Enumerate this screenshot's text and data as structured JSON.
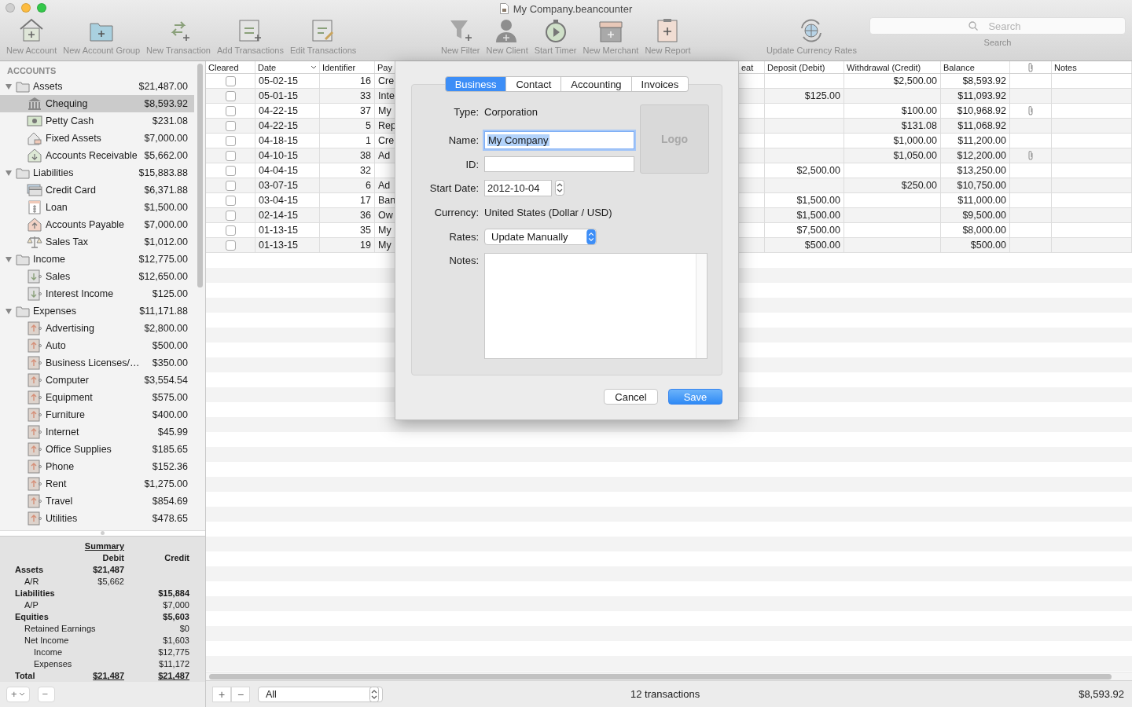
{
  "window": {
    "title": "My Company.beancounter"
  },
  "toolbar": {
    "groups": [
      {
        "items": [
          {
            "label": "New Account"
          },
          {
            "label": "New Account Group"
          },
          {
            "label": "New Transaction"
          },
          {
            "label": "Add Transactions"
          },
          {
            "label": "Edit Transactions"
          }
        ]
      },
      {
        "items": [
          {
            "label": "New Filter"
          },
          {
            "label": "New Client"
          },
          {
            "label": "Start Timer"
          },
          {
            "label": "New Merchant"
          },
          {
            "label": "New Report"
          }
        ]
      },
      {
        "items": [
          {
            "label": "Update Currency Rates"
          }
        ]
      }
    ],
    "search": {
      "placeholder": "Search",
      "label": "Search"
    }
  },
  "sidebar": {
    "heading": "ACCOUNTS",
    "groups": [
      {
        "name": "Assets",
        "amount": "$21,487.00",
        "expanded": true,
        "selected": false,
        "children": [
          {
            "name": "Chequing",
            "amount": "$8,593.92",
            "kind": "bank",
            "selected": true
          },
          {
            "name": "Petty Cash",
            "amount": "$231.08",
            "kind": "cash",
            "selected": false
          },
          {
            "name": "Fixed Assets",
            "amount": "$7,000.00",
            "kind": "asset",
            "selected": false
          },
          {
            "name": "Accounts Receivable",
            "amount": "$5,662.00",
            "kind": "receivable",
            "selected": false
          }
        ]
      },
      {
        "name": "Liabilities",
        "amount": "$15,883.88",
        "expanded": true,
        "selected": false,
        "children": [
          {
            "name": "Credit Card",
            "amount": "$6,371.88",
            "kind": "card",
            "selected": false
          },
          {
            "name": "Loan",
            "amount": "$1,500.00",
            "kind": "loan",
            "selected": false
          },
          {
            "name": "Accounts Payable",
            "amount": "$7,000.00",
            "kind": "payable",
            "selected": false
          },
          {
            "name": "Sales Tax",
            "amount": "$1,012.00",
            "kind": "tax",
            "selected": false
          }
        ]
      },
      {
        "name": "Income",
        "amount": "$12,775.00",
        "expanded": true,
        "selected": false,
        "children": [
          {
            "name": "Sales",
            "amount": "$12,650.00",
            "kind": "income",
            "selected": false
          },
          {
            "name": "Interest Income",
            "amount": "$125.00",
            "kind": "income",
            "selected": false
          }
        ]
      },
      {
        "name": "Expenses",
        "amount": "$11,171.88",
        "expanded": true,
        "selected": false,
        "children": [
          {
            "name": "Advertising",
            "amount": "$2,800.00",
            "kind": "expense",
            "selected": false
          },
          {
            "name": "Auto",
            "amount": "$500.00",
            "kind": "expense",
            "selected": false
          },
          {
            "name": "Business Licenses/…",
            "amount": "$350.00",
            "kind": "expense",
            "selected": false
          },
          {
            "name": "Computer",
            "amount": "$3,554.54",
            "kind": "expense",
            "selected": false
          },
          {
            "name": "Equipment",
            "amount": "$575.00",
            "kind": "expense",
            "selected": false
          },
          {
            "name": "Furniture",
            "amount": "$400.00",
            "kind": "expense",
            "selected": false
          },
          {
            "name": "Internet",
            "amount": "$45.99",
            "kind": "expense",
            "selected": false
          },
          {
            "name": "Office Supplies",
            "amount": "$185.65",
            "kind": "expense",
            "selected": false
          },
          {
            "name": "Phone",
            "amount": "$152.36",
            "kind": "expense",
            "selected": false
          },
          {
            "name": "Rent",
            "amount": "$1,275.00",
            "kind": "expense",
            "selected": false
          },
          {
            "name": "Travel",
            "amount": "$854.69",
            "kind": "expense",
            "selected": false
          },
          {
            "name": "Utilities",
            "amount": "$478.65",
            "kind": "expense",
            "selected": false
          }
        ]
      }
    ],
    "buttons": [
      {
        "label": "+"
      },
      {
        "label": "−"
      }
    ]
  },
  "summary": {
    "title": "Summary",
    "columns": [
      "Debit",
      "Credit"
    ],
    "rows": [
      {
        "label": "Assets",
        "debit": "$21,487",
        "children": [
          {
            "label": "A/R",
            "debit": "$5,662"
          }
        ]
      },
      {
        "label": "Liabilities",
        "credit": "$15,884",
        "children": [
          {
            "label": "A/P",
            "credit": "$7,000"
          }
        ]
      },
      {
        "label": "Equities",
        "credit": "$5,603",
        "children": [
          {
            "label": "Retained Earnings",
            "credit": "$0"
          },
          {
            "label": "Net Income",
            "credit": "$1,603",
            "children": [
              {
                "label": "Income",
                "credit": "$12,775"
              },
              {
                "label": "Expenses",
                "credit": "$11,172"
              }
            ]
          }
        ]
      },
      {
        "label": "Total",
        "kind": "total",
        "debit": "$21,487",
        "credit": "$21,487"
      }
    ]
  },
  "table": {
    "columns": [
      "Cleared",
      "Date",
      "Identifier",
      "Pay",
      "eat",
      "Deposit (Debit)",
      "Withdrawal (Credit)",
      "Balance",
      "Notes"
    ],
    "rows": [
      {
        "cleared": false,
        "date": "05-02-15",
        "identifier": "16",
        "payee": "Cre",
        "withdrawal": "$2,500.00",
        "balance": "$8,593.92",
        "attachment": false
      },
      {
        "cleared": false,
        "date": "05-01-15",
        "identifier": "33",
        "payee": "Inte",
        "deposit": "$125.00",
        "balance": "$11,093.92",
        "attachment": false
      },
      {
        "cleared": false,
        "date": "04-22-15",
        "identifier": "37",
        "payee": "My",
        "withdrawal": "$100.00",
        "balance": "$10,968.92",
        "attachment": true
      },
      {
        "cleared": false,
        "date": "04-22-15",
        "identifier": "5",
        "payee": "Rep",
        "withdrawal": "$131.08",
        "balance": "$11,068.92",
        "attachment": false
      },
      {
        "cleared": false,
        "date": "04-18-15",
        "identifier": "1",
        "payee": "Cre",
        "withdrawal": "$1,000.00",
        "balance": "$11,200.00",
        "attachment": false
      },
      {
        "cleared": false,
        "date": "04-10-15",
        "identifier": "38",
        "payee": "Ad",
        "withdrawal": "$1,050.00",
        "balance": "$12,200.00",
        "attachment": true
      },
      {
        "cleared": false,
        "date": "04-04-15",
        "identifier": "32",
        "deposit": "$2,500.00",
        "balance": "$13,250.00",
        "attachment": false
      },
      {
        "cleared": false,
        "date": "03-07-15",
        "identifier": "6",
        "payee": "Ad",
        "withdrawal": "$250.00",
        "balance": "$10,750.00",
        "attachment": false
      },
      {
        "cleared": false,
        "date": "03-04-15",
        "identifier": "17",
        "payee": "Ban",
        "deposit": "$1,500.00",
        "balance": "$11,000.00",
        "attachment": false
      },
      {
        "cleared": false,
        "date": "02-14-15",
        "identifier": "36",
        "payee": "Ow",
        "deposit": "$1,500.00",
        "balance": "$9,500.00",
        "attachment": false
      },
      {
        "cleared": false,
        "date": "01-13-15",
        "identifier": "35",
        "payee": "My",
        "deposit": "$7,500.00",
        "balance": "$8,000.00",
        "attachment": false
      },
      {
        "cleared": false,
        "date": "01-13-15",
        "identifier": "19",
        "payee": "My",
        "deposit": "$500.00",
        "balance": "$500.00",
        "attachment": false
      }
    ]
  },
  "footer": {
    "buttons": [
      {
        "label": "+"
      },
      {
        "label": "−"
      }
    ],
    "filter": "All",
    "count": "12 transactions",
    "balance": "$8,593.92"
  },
  "dialog": {
    "tabs": [
      {
        "label": "Business",
        "selected": true
      },
      {
        "label": "Contact",
        "selected": false
      },
      {
        "label": "Accounting",
        "selected": false
      },
      {
        "label": "Invoices",
        "selected": false
      }
    ],
    "type_label": "Type:",
    "type": "Corporation",
    "name_label": "Name:",
    "name": "My Company",
    "id_label": "ID:",
    "start_date_label": "Start Date:",
    "start_date": "2012-10-04",
    "currency_label": "Currency:",
    "currency": "United States (Dollar / USD)",
    "rates_label": "Rates:",
    "rates": "Update Manually",
    "notes_label": "Notes:",
    "logo": "Logo",
    "buttons": [
      {
        "label": "Cancel",
        "kind": "normal"
      },
      {
        "label": "Save",
        "kind": "default"
      }
    ]
  }
}
